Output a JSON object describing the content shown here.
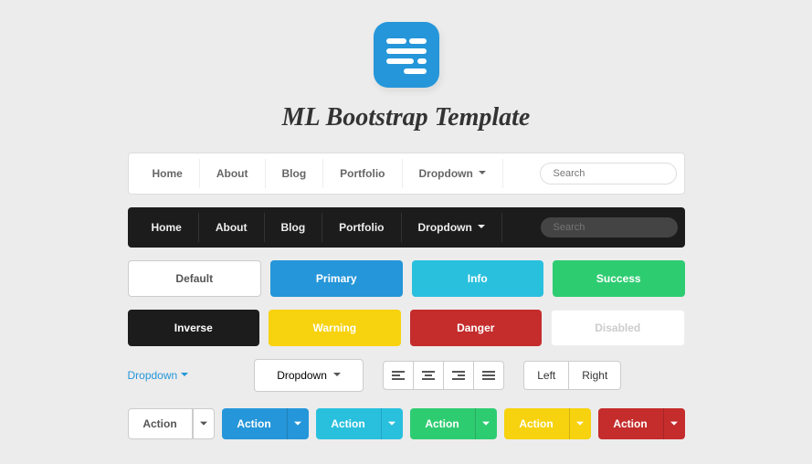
{
  "title": "ML Bootstrap Template",
  "nav": {
    "items": [
      "Home",
      "About",
      "Blog",
      "Portfolio",
      "Dropdown"
    ],
    "search_placeholder": "Search"
  },
  "buttons": {
    "default": "Default",
    "primary": "Primary",
    "info": "Info",
    "success": "Success",
    "inverse": "Inverse",
    "warning": "Warning",
    "danger": "Danger",
    "disabled": "Disabled"
  },
  "dropdown_link": "Dropdown",
  "dropdown_btn": "Dropdown",
  "segment": {
    "left": "Left",
    "right": "Right"
  },
  "split_label": "Action"
}
